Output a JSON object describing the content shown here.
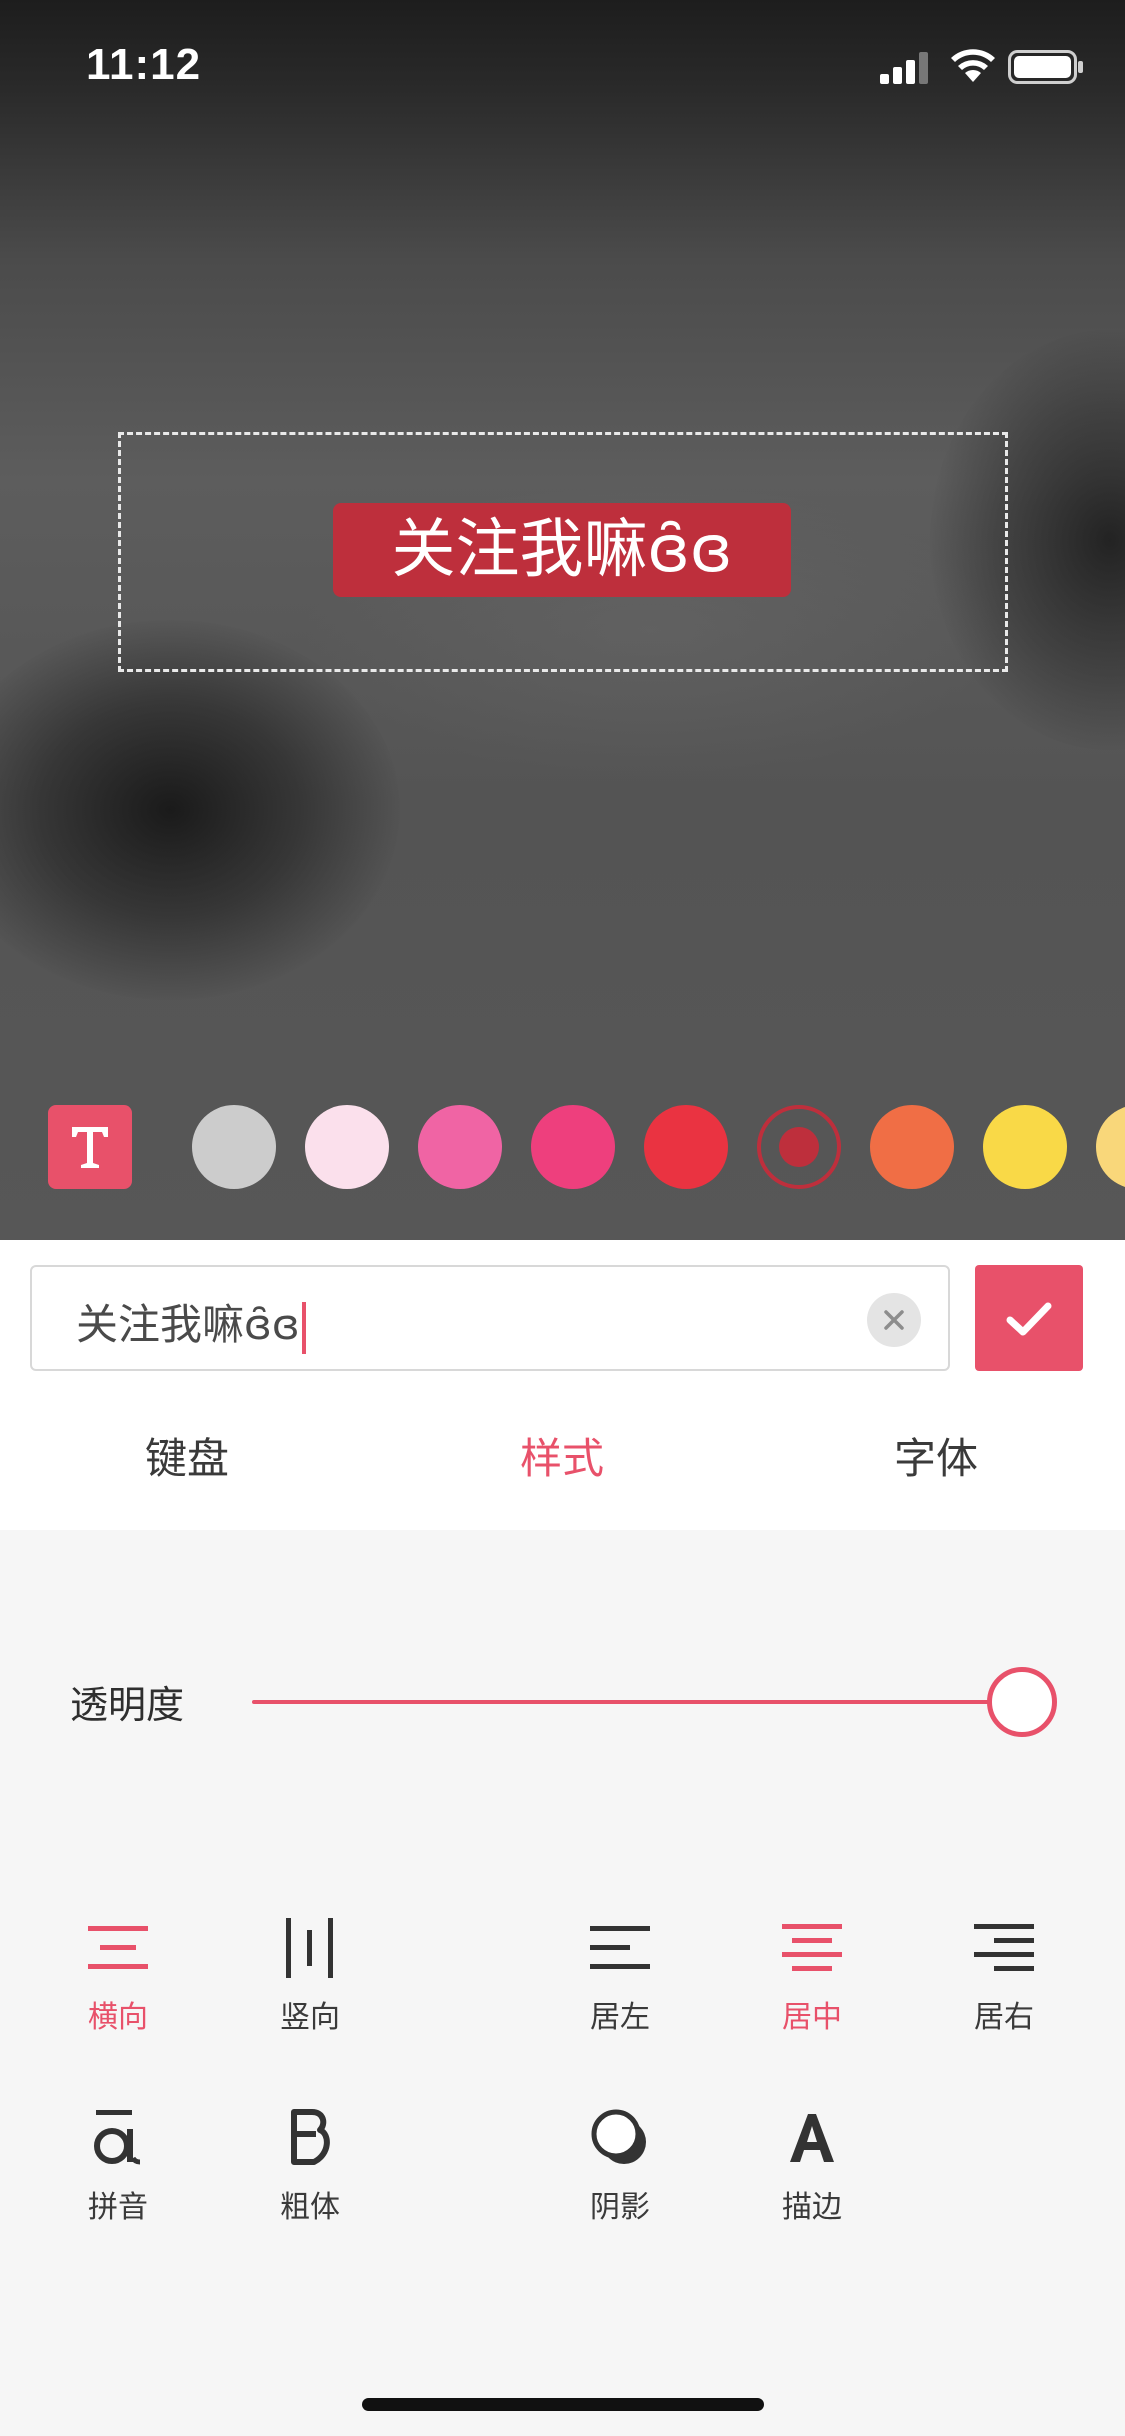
{
  "status_bar": {
    "time": "11:12"
  },
  "canvas": {
    "text": "关注我嘛ɞ̑ɞ",
    "text_bg_color": "#be2f3c"
  },
  "colors": {
    "accent": "#e8516a",
    "swatches": [
      "#cccccc",
      "#fbe0ec",
      "#f064a4",
      "#ee3f7d",
      "#ea3341",
      "#be2f3c",
      "#f06e45",
      "#f9d947",
      "#f9d77a"
    ],
    "selected_index": 5
  },
  "editor": {
    "input_value": "关注我嘛ɞ̑ɞ",
    "tabs": [
      {
        "label": "键盘"
      },
      {
        "label": "样式"
      },
      {
        "label": "字体"
      }
    ],
    "active_tab": "样式"
  },
  "style": {
    "opacity_label": "透明度",
    "opacity_value": 1.0,
    "tools": {
      "horizontal": "横向",
      "vertical": "竖向",
      "align_left": "居左",
      "align_center": "居中",
      "align_right": "居右",
      "pinyin": "拼音",
      "bold": "粗体",
      "shadow": "阴影",
      "stroke": "描边"
    }
  }
}
